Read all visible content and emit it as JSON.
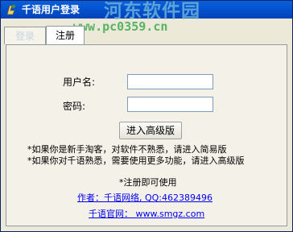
{
  "window": {
    "title": "千语用户登录",
    "watermark_text": "河东软件园",
    "watermark_url": "www.pc0359.cn"
  },
  "tabs": [
    {
      "label": "登录"
    },
    {
      "label": "注册"
    }
  ],
  "form": {
    "username_label": "用户名:",
    "username_value": "",
    "password_label": "密码:",
    "password_value": "",
    "submit_label": "进入高级版"
  },
  "notes": {
    "line1": "*如果你是新手淘客，对软件不熟悉，请进入简易版",
    "line2": "*如果你对千语熟悉，需要使用更多功能，请进入高级版",
    "register_hint": "*注册即可使用"
  },
  "links": {
    "author": "作者：千语网络, QQ:462389496",
    "website": "千语官网： www.smgz.com"
  },
  "colors": {
    "titlebar": "#0454d0",
    "link": "#0000ee",
    "panel": "#f4f2e8"
  }
}
